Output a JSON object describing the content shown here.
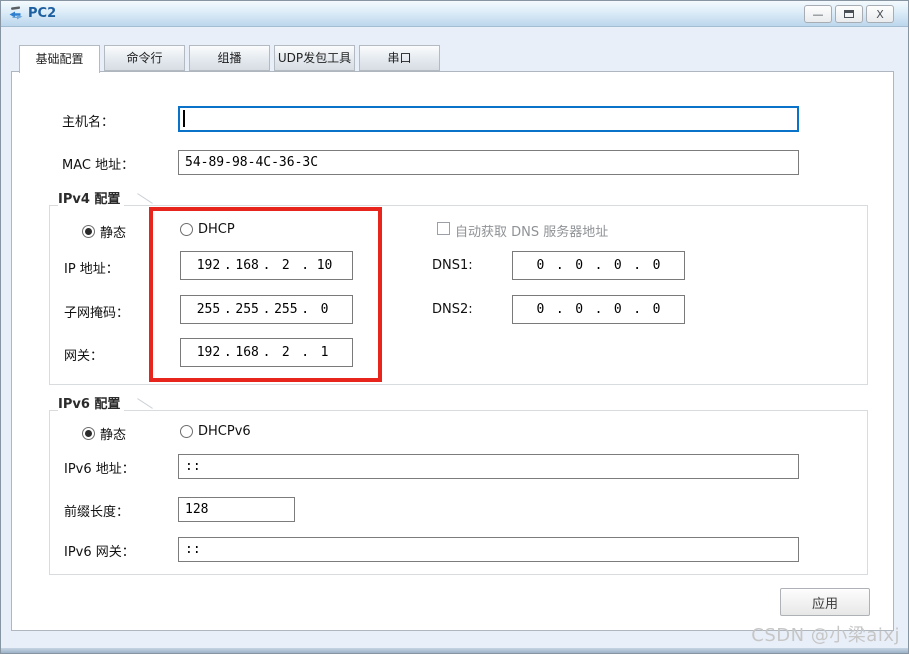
{
  "window": {
    "title": "PC2",
    "controls": {
      "minimize": "—",
      "close": "X"
    }
  },
  "tabs": [
    {
      "label": "基础配置",
      "active": true
    },
    {
      "label": "命令行",
      "active": false
    },
    {
      "label": "组播",
      "active": false
    },
    {
      "label": "UDP发包工具",
      "active": false
    },
    {
      "label": "串口",
      "active": false
    }
  ],
  "basic": {
    "hostname_label": "主机名：",
    "hostname_value": "",
    "mac_label": "MAC 地址：",
    "mac_value": "54-89-98-4C-36-3C",
    "ipv4": {
      "group_label": "IPv4 配置",
      "static_label": "静态",
      "static_selected": true,
      "dhcp_label": "DHCP",
      "dhcp_selected": false,
      "ip_label": "IP 地址：",
      "ip_value": [
        "192",
        "168",
        "2",
        "10"
      ],
      "mask_label": "子网掩码：",
      "mask_value": [
        "255",
        "255",
        "255",
        "0"
      ],
      "gateway_label": "网关：",
      "gateway_value": [
        "192",
        "168",
        "2",
        "1"
      ],
      "dns_auto_label": "自动获取 DNS 服务器地址",
      "dns_auto_checked": false,
      "dns1_label": "DNS1:",
      "dns1_value": [
        "0",
        "0",
        "0",
        "0"
      ],
      "dns2_label": "DNS2:",
      "dns2_value": [
        "0",
        "0",
        "0",
        "0"
      ]
    },
    "ipv6": {
      "group_label": "IPv6 配置",
      "static_label": "静态",
      "static_selected": true,
      "dhcp_label": "DHCPv6",
      "dhcp_selected": false,
      "addr_label": "IPv6 地址：",
      "addr_value": "::",
      "prefix_label": "前缀长度：",
      "prefix_value": "128",
      "gateway_label": "IPv6 网关：",
      "gateway_value": "::"
    },
    "apply_label": "应用"
  },
  "ui": {
    "dot": "."
  },
  "watermark": "CSDN @小梁aixj",
  "colors": {
    "focus_border_blue": "#0a72c8",
    "annotation_red": "#e8251c",
    "title_blue": "#1d5fa0",
    "watermark_gray": "#c6c6c6",
    "titlebar_gradient_bottom": "#bcd6ec"
  }
}
